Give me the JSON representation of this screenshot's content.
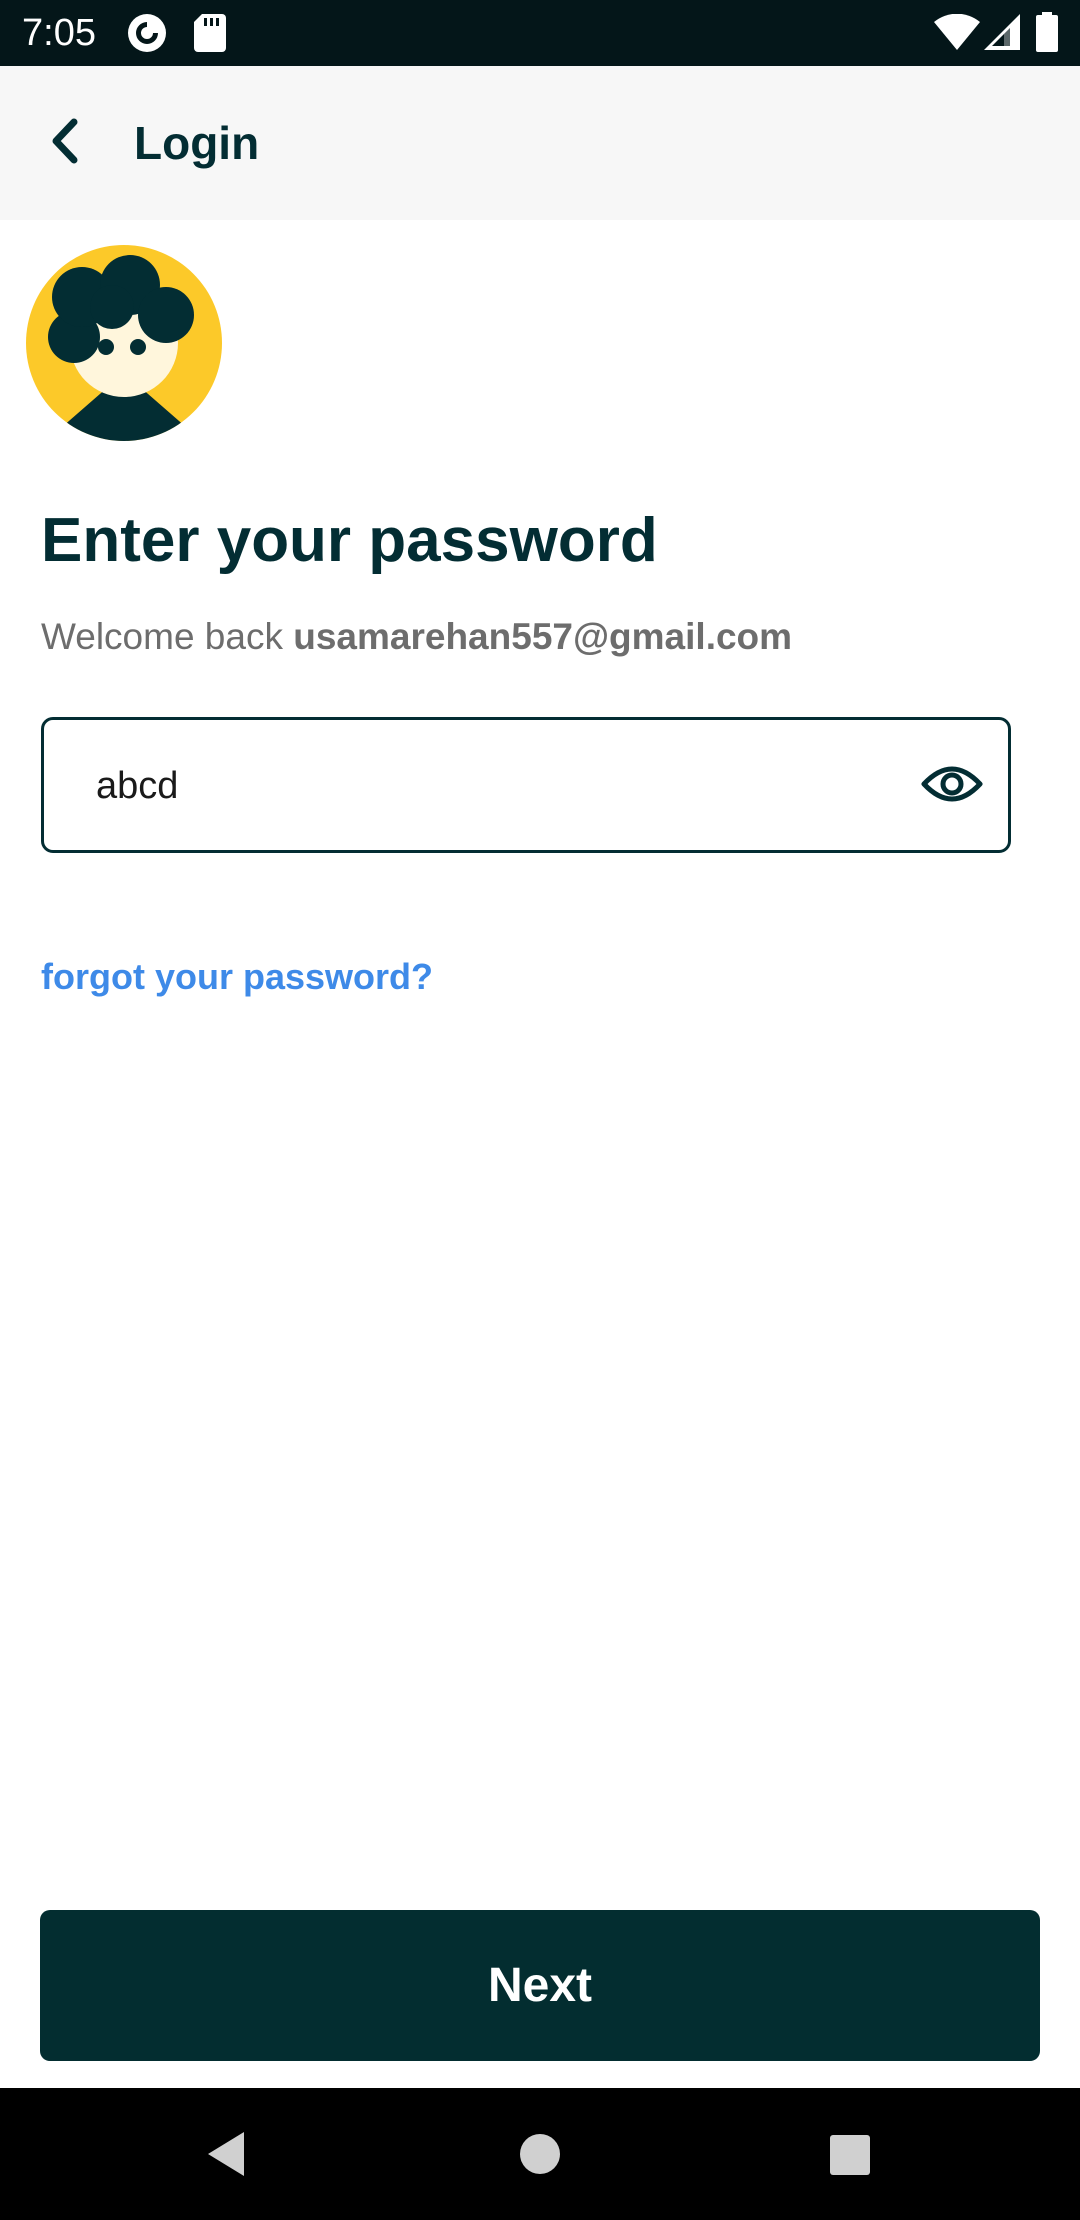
{
  "status_bar": {
    "time": "7:05",
    "icons": [
      "pocket-casts-icon",
      "sd-card-icon",
      "wifi-icon",
      "signal-icon",
      "battery-icon"
    ]
  },
  "app_bar": {
    "back_icon": "chevron-left-icon",
    "title": "Login"
  },
  "main": {
    "avatar_icon": "user-avatar-illustration",
    "title": "Enter your password",
    "welcome_prefix": "Welcome back ",
    "email": "usamarehan557@gmail.com",
    "password_value": "abcd",
    "visibility_icon": "eye-icon",
    "forgot_link": "forgot your password?"
  },
  "footer": {
    "next_label": "Next"
  },
  "nav_bar": {
    "icons": [
      "back-triangle-icon",
      "home-circle-icon",
      "recents-square-icon"
    ]
  },
  "colors": {
    "primary": "#032d33",
    "link": "#3e8ae8",
    "avatar_yellow": "#fcc929",
    "status_bar": "#041619"
  }
}
